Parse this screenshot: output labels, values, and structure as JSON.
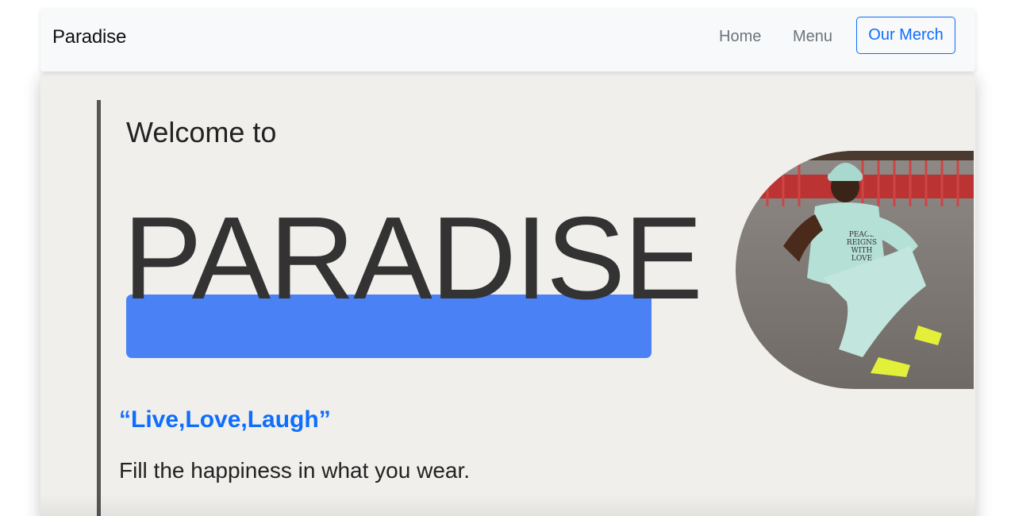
{
  "nav": {
    "brand": "Paradise",
    "links": [
      "Home",
      "Menu"
    ],
    "cta_label": "Our Merch"
  },
  "hero": {
    "welcome": "Welcome to",
    "title": "PARADISE",
    "quote": "“Live,Love,Laugh”",
    "tagline": "Fill the happiness in what you wear.",
    "photo_shirt_text": [
      "PEACE",
      "REIGNS",
      "WITH",
      "LOVE"
    ]
  },
  "colors": {
    "accent": "#0d6efd",
    "highlight": "#4a82f5",
    "card_bg": "#f0efec",
    "nav_bg": "#f8f9fa"
  }
}
